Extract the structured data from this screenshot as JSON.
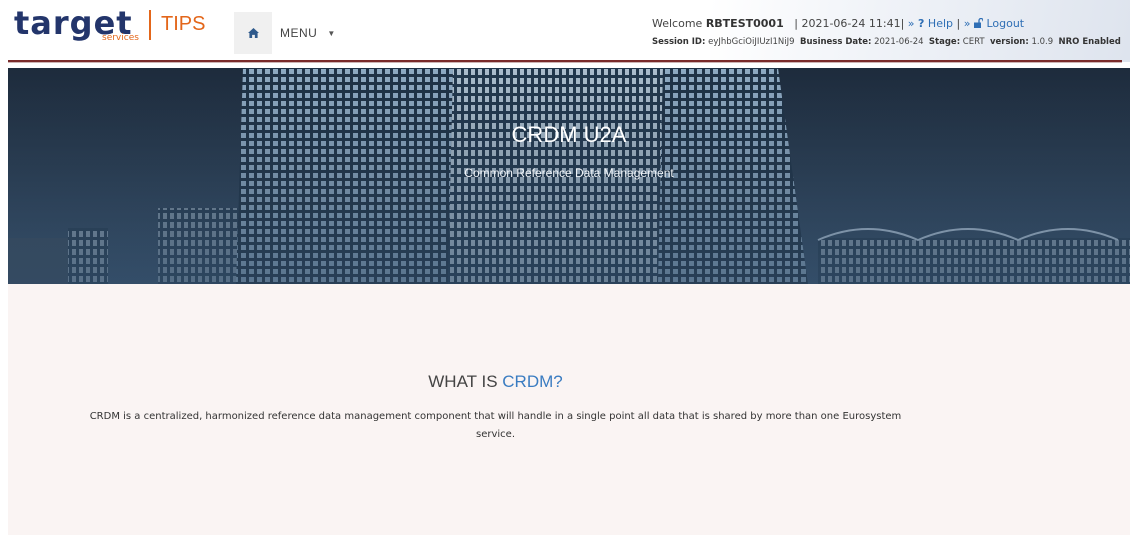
{
  "header": {
    "logo_word": "target",
    "logo_sub": "services",
    "app_name": "TIPS",
    "menu_label": "MENU",
    "welcome_label": "Welcome",
    "username": "RBTEST0001",
    "datetime": "2021-06-24 11:41",
    "help_label": "Help",
    "logout_label": "Logout",
    "session_label": "Session ID:",
    "session_id": "eyJhbGciOiJIUzI1NiJ9",
    "business_date_label": "Business Date:",
    "business_date": "2021-06-24",
    "stage_label": "Stage:",
    "stage": "CERT",
    "version_label": "version:",
    "version": "1.0.9",
    "nro_label": "NRO Enabled"
  },
  "hero": {
    "title": "CRDM U2A",
    "subtitle": "Common Reference Data Management"
  },
  "content": {
    "title_prefix": "WHAT IS ",
    "title_accent": "CRDM?",
    "description": "CRDM is a centralized, harmonized reference data management component that will handle in a single point all data that is shared by more than one Eurosystem service."
  },
  "colors": {
    "brand_navy": "#23356b",
    "brand_orange": "#e3661a",
    "link_blue": "#2f6fb5",
    "accent_blue": "#3a7cc1",
    "rule": "#7a2b2b"
  },
  "icons": {
    "home": "home-icon",
    "help": "question-icon",
    "logout": "unlock-icon",
    "caret": "caret-down-icon"
  }
}
